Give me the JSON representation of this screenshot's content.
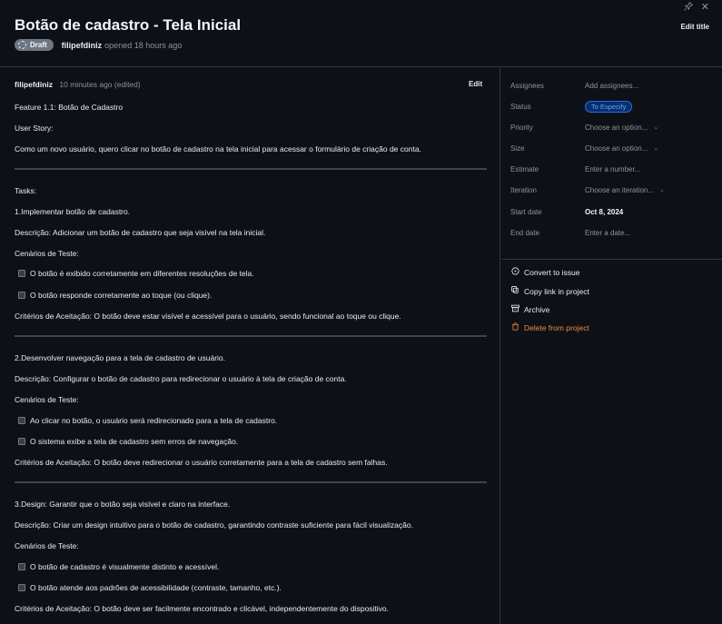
{
  "header": {
    "title": "Botão de cadastro - Tela Inicial",
    "badge": "Draft",
    "author": "filipefdiniz",
    "opened": "opened 18 hours ago",
    "edit_title": "Edit title"
  },
  "comment": {
    "author": "filipefdiniz",
    "time": "10 minutes ago (edited)",
    "edit": "Edit"
  },
  "body": {
    "feature": "Feature 1.1: Botão de Cadastro",
    "user_story_label": "User Story:",
    "user_story": "Como um novo usuário, quero clicar no botão de cadastro na tela inicial para acessar o formulário de criação de conta.",
    "tasks_label": "Tasks:",
    "sections": [
      {
        "title": "1.Implementar botão de cadastro.",
        "description": "Descrição: Adicionar um botão de cadastro que seja visível na tela inicial.",
        "scenarios_label": "Cenários de Teste:",
        "tasks": [
          "O botão é exibido corretamente em diferentes resoluções de tela.",
          "O botão responde corretamente ao toque (ou clique)."
        ],
        "criteria": "Critérios de Aceitação: O botão deve estar visível e acessível para o usuário, sendo funcional ao toque ou clique."
      },
      {
        "title": "2.Desenvolver navegação para a tela de cadastro de usuário.",
        "description": "Descrição: Configurar o botão de cadastro para redirecionar o usuário à tela de criação de conta.",
        "scenarios_label": "Cenários de Teste:",
        "tasks": [
          "Ao clicar no botão, o usuário será redirecionado para a tela de cadastro.",
          "O sistema exibe a tela de cadastro sem erros de navegação."
        ],
        "criteria": "Critérios de Aceitação: O botão deve redirecionar o usuário corretamente para a tela de cadastro sem falhas."
      },
      {
        "title": "3.Design: Garantir que o botão seja visível e claro na interface.",
        "description": "Descrição: Criar um design intuitivo para o botão de cadastro, garantindo contraste suficiente para fácil visualização.",
        "scenarios_label": "Cenários de Teste:",
        "tasks": [
          "O botão de cadastro é visualmente distinto e acessível.",
          "O botão atende aos padrões de acessibilidade (contraste, tamanho, etc.)."
        ],
        "criteria": "Critérios de Aceitação: O botão deve ser facilmente encontrado e clicável, independentemente do dispositivo."
      }
    ]
  },
  "sidebar": {
    "fields": [
      {
        "label": "Assignees",
        "value": "Add assignees..."
      },
      {
        "label": "Status",
        "value": "To Especify"
      },
      {
        "label": "Priority",
        "value": "Choose an option..."
      },
      {
        "label": "Size",
        "value": "Choose an option..."
      },
      {
        "label": "Estimate",
        "value": "Enter a number..."
      },
      {
        "label": "Iteration",
        "value": "Choose an iteration..."
      },
      {
        "label": "Start date",
        "value": "Oct 8, 2024"
      },
      {
        "label": "End date",
        "value": "Enter a date..."
      }
    ],
    "actions": [
      {
        "label": "Convert to issue",
        "icon": "issue-opened-icon"
      },
      {
        "label": "Copy link in project",
        "icon": "link-icon"
      },
      {
        "label": "Archive",
        "icon": "archive-icon"
      },
      {
        "label": "Delete from project",
        "icon": "trash-icon"
      }
    ]
  },
  "colors": {
    "background": "#0d1117",
    "border": "#30363d",
    "status_accent": "#58a6ff",
    "danger": "#f0883e"
  }
}
